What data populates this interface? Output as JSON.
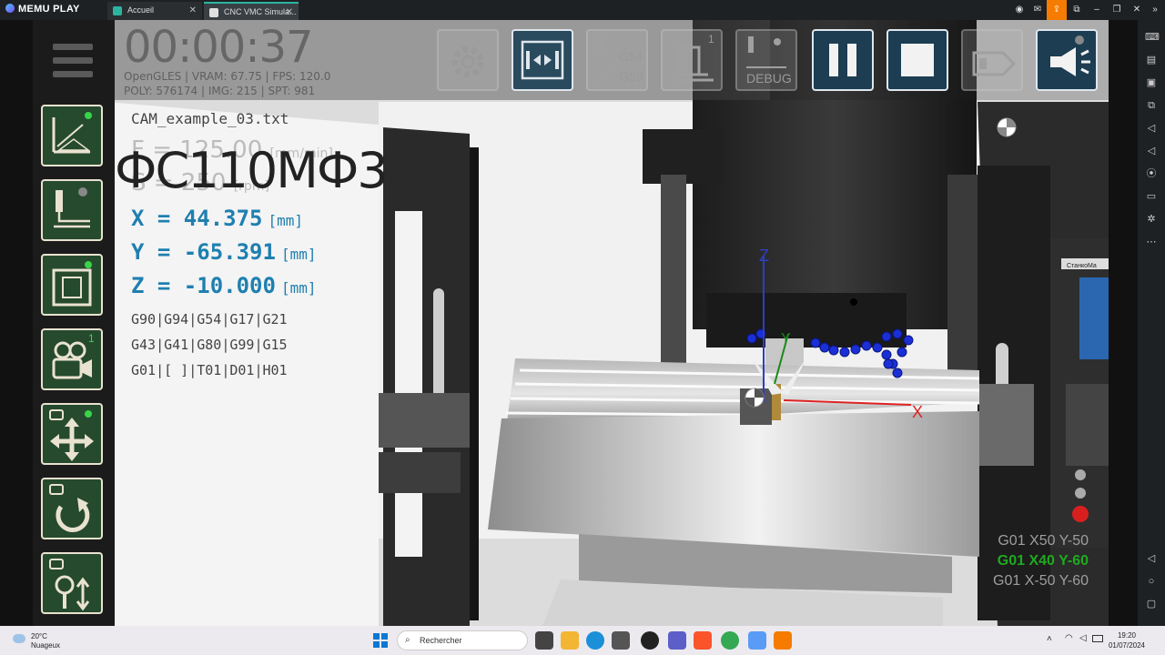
{
  "emulator": {
    "brand": "MEMU PLAY",
    "tabs": [
      {
        "label": "Accueil",
        "close": "✕"
      },
      {
        "label": "CNC VMC Simula...",
        "close": "✕"
      }
    ]
  },
  "hud": {
    "timer": "00:00:37",
    "stats_line1": "OpenGLES | VRAM: 67.75 | FPS: 120.0",
    "stats_line2": "POLY: 576174 | IMG: 215 | SPT: 981",
    "file_name": "CAM_example_03.txt",
    "feed_label": "F = 125.00",
    "feed_unit": "[mm/min]",
    "speed_label": "S = 250",
    "speed_unit": "[rpm]",
    "machine_model": "ФС110МФ3",
    "coords": [
      {
        "axis": "X = 44.375",
        "unit": "[mm]"
      },
      {
        "axis": "Y = -65.391",
        "unit": "[mm]"
      },
      {
        "axis": "Z = -10.000",
        "unit": "[mm]"
      }
    ],
    "gcode_states": [
      "G90|G94|G54|G17|G21",
      "G43|G41|G80|G99|G15",
      "G01|[ ]|T01|D01|H01"
    ],
    "program_lines": [
      {
        "text": "G01 X50 Y-50",
        "color": "#9e9e9e"
      },
      {
        "text": "G01 X40 Y-60",
        "color": "#1faa1f"
      },
      {
        "text": "G01 X-50 Y-60",
        "color": "#9e9e9e"
      }
    ]
  },
  "toolbar": {
    "g54_label": "G54",
    "g59_label": "G59",
    "debug_label": "DEBUG",
    "view_badge": "1"
  },
  "left_toolbar": {
    "camera_badge": "1"
  },
  "scene": {
    "axis_x": "X",
    "axis_y": "Y",
    "axis_z": "Z",
    "panel_brand": "СтанкоМа"
  },
  "taskbar": {
    "temperature": "20°C",
    "condition": "Nuageux",
    "search_placeholder": "Rechercher",
    "time": "19:20",
    "date": "01/07/2024"
  },
  "colors": {
    "accent_teal": "#2bb5a0",
    "coord_blue": "#1f7fb0",
    "active_green": "#37d54a",
    "record_orange": "#f57c00"
  }
}
